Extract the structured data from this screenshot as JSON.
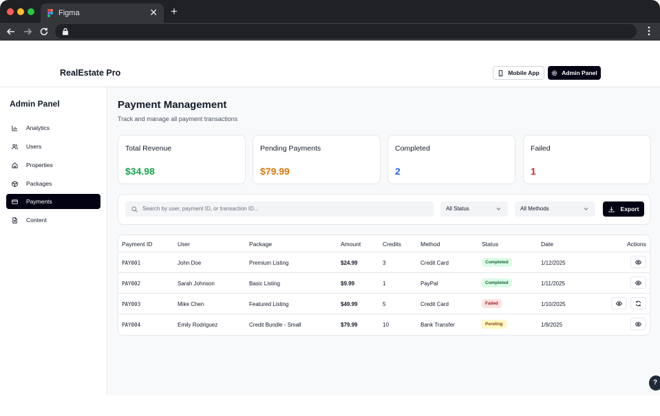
{
  "browser": {
    "tab_title": "Figma",
    "tab_close": "✕",
    "new_tab": "+"
  },
  "header": {
    "brand": "RealEstate Pro",
    "mobile_app_label": "Mobile App",
    "admin_panel_label": "Admin Panel"
  },
  "sidebar": {
    "title": "Admin Panel",
    "items": [
      {
        "label": "Analytics",
        "icon": "bar-chart-icon",
        "active": false
      },
      {
        "label": "Users",
        "icon": "users-icon",
        "active": false
      },
      {
        "label": "Properties",
        "icon": "home-icon",
        "active": false
      },
      {
        "label": "Packages",
        "icon": "package-icon",
        "active": false
      },
      {
        "label": "Payments",
        "icon": "credit-card-icon",
        "active": true
      },
      {
        "label": "Content",
        "icon": "file-text-icon",
        "active": false
      }
    ]
  },
  "page": {
    "title": "Payment Management",
    "subtitle": "Track and manage all payment transactions"
  },
  "stats": [
    {
      "label": "Total Revenue",
      "value": "$34.98",
      "color": "#16a34a"
    },
    {
      "label": "Pending Payments",
      "value": "$79.99",
      "color": "#d97706"
    },
    {
      "label": "Completed",
      "value": "2",
      "color": "#2563eb"
    },
    {
      "label": "Failed",
      "value": "1",
      "color": "#dc2626"
    }
  ],
  "filters": {
    "search_placeholder": "Search by user, payment ID, or transaction ID...",
    "status_selected": "All Status",
    "method_selected": "All Methods",
    "export_label": "Export"
  },
  "table": {
    "headers": [
      "Payment ID",
      "User",
      "Package",
      "Amount",
      "Credits",
      "Method",
      "Status",
      "Date",
      "Actions"
    ],
    "rows": [
      {
        "id": "PAY001",
        "user": "John Doe",
        "package": "Premium Listing",
        "amount": "$24.99",
        "credits": "3",
        "method": "Credit Card",
        "status": "Completed",
        "date": "1/12/2025"
      },
      {
        "id": "PAY002",
        "user": "Sarah Johnson",
        "package": "Basic Listing",
        "amount": "$9.99",
        "credits": "1",
        "method": "PayPal",
        "status": "Completed",
        "date": "1/11/2025"
      },
      {
        "id": "PAY003",
        "user": "Mike Chen",
        "package": "Featured Listing",
        "amount": "$49.99",
        "credits": "5",
        "method": "Credit Card",
        "status": "Failed",
        "date": "1/10/2025"
      },
      {
        "id": "PAY004",
        "user": "Emily Rodriguez",
        "package": "Credit Bundle - Small",
        "amount": "$79.99",
        "credits": "10",
        "method": "Bank Transfer",
        "status": "Pending",
        "date": "1/9/2025"
      }
    ]
  },
  "help_label": "?"
}
